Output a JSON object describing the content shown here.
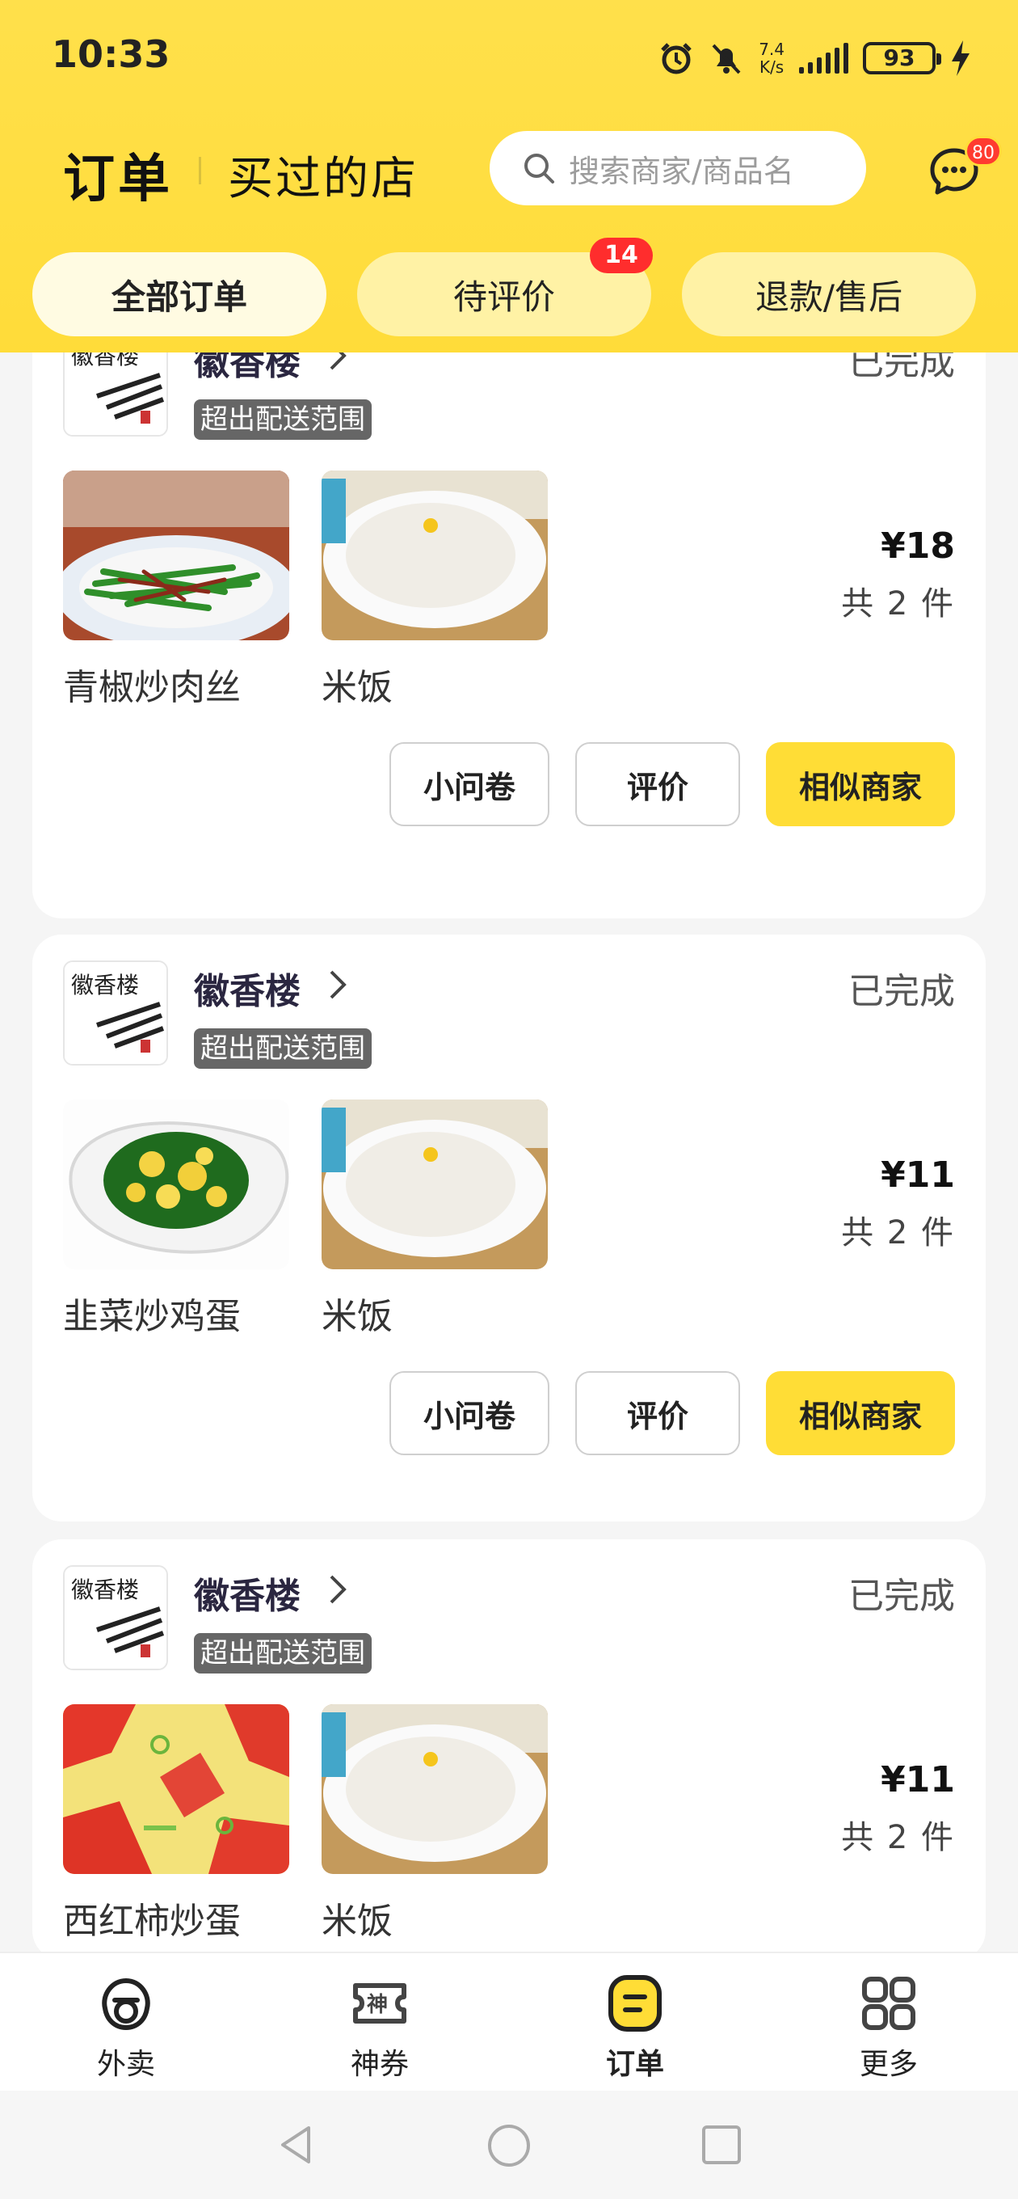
{
  "status_bar": {
    "time": "10:33",
    "net_speed_value": "7.4",
    "net_speed_unit": "K/s",
    "battery": "93",
    "icons": [
      "alarm-icon",
      "mute-icon",
      "signal-icon",
      "battery-icon",
      "charging-icon"
    ]
  },
  "header": {
    "tab_orders": "订单",
    "tab_shops": "买过的店",
    "search_placeholder": "搜索商家/商品名",
    "message_badge": "80"
  },
  "filters": [
    {
      "label": "全部订单",
      "active": true
    },
    {
      "label": "待评价",
      "badge": "14"
    },
    {
      "label": "退款/售后"
    }
  ],
  "orders": [
    {
      "shop": "徽香楼",
      "status": "已完成",
      "tag": "超出配送范围",
      "items": [
        {
          "name": "青椒炒肉丝",
          "image": "green-pepper-pork"
        },
        {
          "name": "米饭",
          "image": "rice"
        }
      ],
      "price": "¥18",
      "qty": "共 2 件",
      "buttons": {
        "survey": "小问卷",
        "review": "评价",
        "similar": "相似商家"
      }
    },
    {
      "shop": "徽香楼",
      "status": "已完成",
      "tag": "超出配送范围",
      "items": [
        {
          "name": "韭菜炒鸡蛋",
          "image": "chive-egg"
        },
        {
          "name": "米饭",
          "image": "rice"
        }
      ],
      "price": "¥11",
      "qty": "共 2 件",
      "buttons": {
        "survey": "小问卷",
        "review": "评价",
        "similar": "相似商家"
      }
    },
    {
      "shop": "徽香楼",
      "status": "已完成",
      "tag": "超出配送范围",
      "items": [
        {
          "name": "西红柿炒蛋",
          "image": "tomato-egg"
        },
        {
          "name": "米饭",
          "image": "rice"
        }
      ],
      "price": "¥11",
      "qty": "共 2 件"
    }
  ],
  "bottom_nav": [
    {
      "label": "外卖",
      "icon": "takeout-icon"
    },
    {
      "label": "神券",
      "icon": "coupon-icon"
    },
    {
      "label": "订单",
      "icon": "order-icon",
      "active": true
    },
    {
      "label": "更多",
      "icon": "more-grid-icon"
    }
  ],
  "colors": {
    "brand_yellow": "#ffdc39",
    "badge_red": "#ff2d2d",
    "tag_gray": "#666666"
  }
}
